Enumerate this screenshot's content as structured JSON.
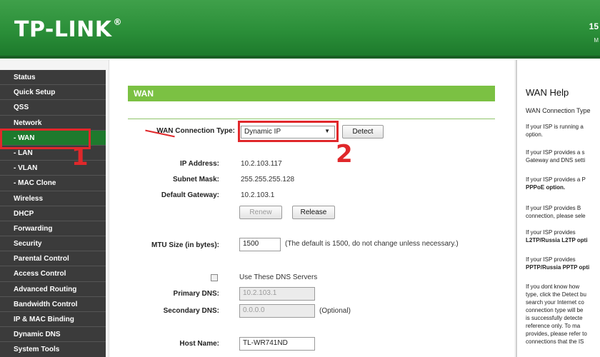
{
  "header": {
    "logo": "TP-LINK",
    "logo_mark": "®",
    "right_number": "15",
    "right_sub": "M"
  },
  "sidebar": {
    "items": [
      {
        "label": "Status",
        "type": "main"
      },
      {
        "label": "Quick Setup",
        "type": "main"
      },
      {
        "label": "QSS",
        "type": "main"
      },
      {
        "label": "Network",
        "type": "section"
      },
      {
        "label": "- WAN",
        "type": "sub",
        "active": true
      },
      {
        "label": "- LAN",
        "type": "sub"
      },
      {
        "label": "- VLAN",
        "type": "sub"
      },
      {
        "label": "- MAC Clone",
        "type": "sub"
      },
      {
        "label": "Wireless",
        "type": "main"
      },
      {
        "label": "DHCP",
        "type": "main"
      },
      {
        "label": "Forwarding",
        "type": "main"
      },
      {
        "label": "Security",
        "type": "main"
      },
      {
        "label": "Parental Control",
        "type": "main"
      },
      {
        "label": "Access Control",
        "type": "main"
      },
      {
        "label": "Advanced Routing",
        "type": "main"
      },
      {
        "label": "Bandwidth Control",
        "type": "main"
      },
      {
        "label": "IP & MAC Binding",
        "type": "main"
      },
      {
        "label": "Dynamic DNS",
        "type": "main"
      },
      {
        "label": "System Tools",
        "type": "main"
      }
    ]
  },
  "wan": {
    "section_title": "WAN",
    "conn_type_label": "WAN Connection Type:",
    "conn_type_value": "Dynamic IP",
    "detect_button": "Detect",
    "ip_label": "IP Address:",
    "ip_value": "10.2.103.117",
    "mask_label": "Subnet Mask:",
    "mask_value": "255.255.255.128",
    "gateway_label": "Default Gateway:",
    "gateway_value": "10.2.103.1",
    "renew_button": "Renew",
    "release_button": "Release",
    "mtu_label": "MTU Size (in bytes):",
    "mtu_value": "1500",
    "mtu_note": "(The default is 1500, do not change unless necessary.)",
    "dns_check_label": "Use These DNS Servers",
    "primary_dns_label": "Primary DNS:",
    "primary_dns_value": "10.2.103.1",
    "secondary_dns_label": "Secondary DNS:",
    "secondary_dns_value": "0.0.0.0",
    "optional_note": "(Optional)",
    "host_label": "Host Name:",
    "host_value": "TL-WR741ND"
  },
  "help": {
    "title": "WAN Help",
    "subtitle": "WAN Connection Type",
    "p1": "If your ISP is running a",
    "p1b": "option.",
    "p2": "If your ISP provides a s",
    "p2b": "Gateway and DNS setti",
    "p3": "If your ISP provides a P",
    "p3b": "PPPoE option.",
    "p4": "If your ISP provides B",
    "p4b": "connection, please sele",
    "p5": "If your ISP provides",
    "p5b": "L2TP/Russia L2TP opti",
    "p6": "If your ISP provides",
    "p6b": "PPTP/Russia PPTP opti",
    "p7a": "If you dont know how",
    "p7b": "type, click the Detect bu",
    "p7c": "search your Internet co",
    "p7d": "connection type will be",
    "p7e": "is successfully detecte",
    "p7f": "reference only. To ma",
    "p7g": "provides, please refer to",
    "p7h": "connections that the IS"
  },
  "annotations": {
    "num1": "1",
    "num2": "2",
    "color": "#e0282b"
  }
}
